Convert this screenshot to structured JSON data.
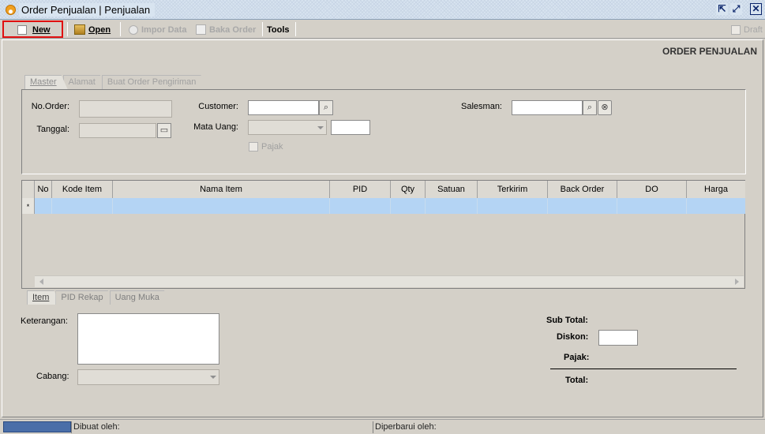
{
  "window": {
    "title": "Order Penjualan | Penjualan",
    "controls": [
      "restore-icon",
      "popout-icon",
      "close-icon"
    ]
  },
  "toolbar": {
    "new_label": "New",
    "open_label": "Open",
    "impor_label": "Impor Data",
    "baka_label": "Baka Order",
    "tools_label": "Tools",
    "draft_label": "Draft",
    "highlight_color": "#e01010"
  },
  "page_title": "ORDER PENJUALAN",
  "top_tabs": [
    "Master",
    "Alamat",
    "Buat Order Pengiriman"
  ],
  "form": {
    "no_order_label": "No.Order:",
    "tanggal_label": "Tanggal:",
    "customer_label": "Customer:",
    "mata_uang_label": "Mata Uang:",
    "pajak_label": "Pajak",
    "salesman_label": "Salesman:"
  },
  "grid": {
    "columns": [
      "No",
      "Kode Item",
      "Nama Item",
      "PID",
      "Qty",
      "Satuan",
      "Terkirim",
      "Back Order",
      "DO",
      "Harga"
    ],
    "new_row_marker": "*",
    "selection_color": "#b4d4f4"
  },
  "bottom_tabs": [
    "Item",
    "PID Rekap",
    "Uang Muka"
  ],
  "footer": {
    "keterangan_label": "Keterangan:",
    "cabang_label": "Cabang:",
    "sub_total_label": "Sub Total:",
    "diskon_label": "Diskon:",
    "pajak_label": "Pajak:",
    "total_label": "Total:"
  },
  "status": {
    "dibuat_label": "Dibuat oleh:",
    "diperbarui_label": "Diperbarui oleh:",
    "progress_color": "#4a6ea8"
  }
}
